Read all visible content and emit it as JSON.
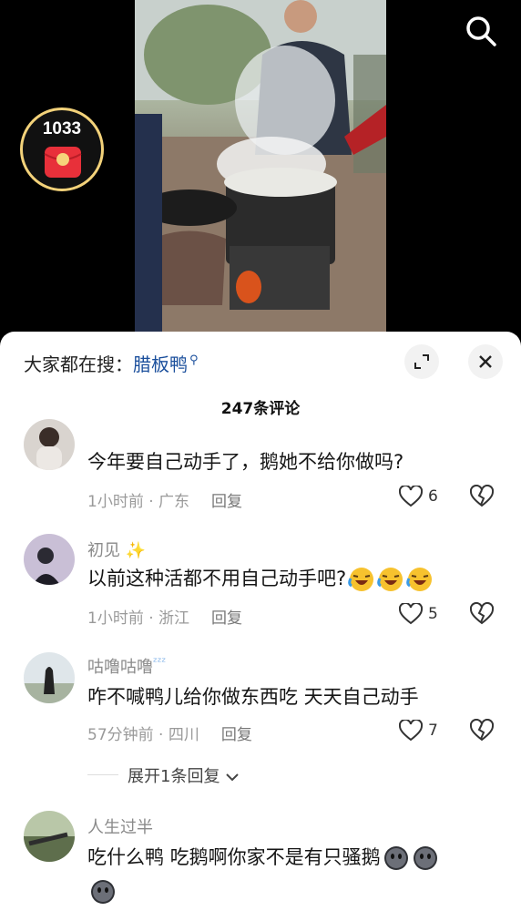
{
  "video": {
    "redpacket_count": "1033",
    "icons": [
      "search-icon",
      "red-envelope-icon"
    ]
  },
  "sheet": {
    "trending_prefix": "大家都在搜：",
    "trending_keyword": "腊板鸭",
    "comment_count_title": "247条评论",
    "icons": [
      "expand-icon",
      "close-icon"
    ]
  },
  "comments": [
    {
      "username": "",
      "text": "今年要自己动手了，鹅她不给你做吗?",
      "time": "1小时前",
      "location": "广东",
      "reply_label": "回复",
      "likes": "6"
    },
    {
      "username": "初见",
      "text": "以前这种活都不用自己动手吧?",
      "time": "1小时前",
      "location": "浙江",
      "reply_label": "回复",
      "likes": "5"
    },
    {
      "username": "咕噜咕噜",
      "text": "咋不喊鸭儿给你做东西吃  天天自己动手",
      "time": "57分钟前",
      "location": "四川",
      "reply_label": "回复",
      "likes": "7",
      "expand_label": "展开1条回复"
    },
    {
      "username": "人生过半",
      "text": "吃什么鸭 吃鹅啊你家不是有只骚鹅"
    }
  ],
  "colors": {
    "keyword": "#1b4f9c",
    "meta": "#9a9a9a",
    "redpacket_ring": "#f3d27a"
  }
}
